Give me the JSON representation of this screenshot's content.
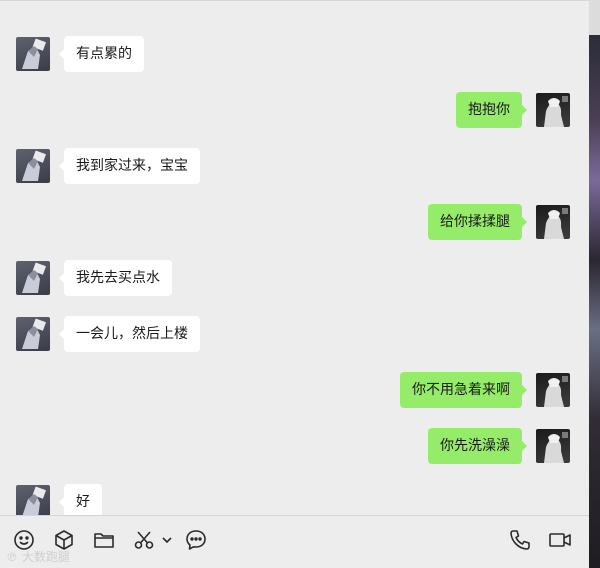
{
  "messages": [
    {
      "side": "other",
      "text": "有点累的"
    },
    {
      "side": "self",
      "text": "抱抱你"
    },
    {
      "side": "other",
      "text": "我到家过来，宝宝"
    },
    {
      "side": "self",
      "text": "给你揉揉腿"
    },
    {
      "side": "other",
      "text": "我先去买点水"
    },
    {
      "side": "other",
      "text": "一会儿，然后上楼"
    },
    {
      "side": "self",
      "text": "你不用急着来啊"
    },
    {
      "side": "self",
      "text": "你先洗澡澡"
    },
    {
      "side": "other",
      "text": "好"
    }
  ],
  "toolbar": {
    "left_icons": [
      "emoji-icon",
      "cube-icon",
      "folder-icon",
      "scissors-icon",
      "chevron-down-icon",
      "chat-bubble-icon"
    ],
    "right_icons": [
      "phone-icon",
      "video-icon"
    ]
  },
  "watermark": "大数跑腿",
  "colors": {
    "self_bubble": "#95ec69",
    "other_bubble": "#ffffff",
    "background": "#ededed"
  }
}
